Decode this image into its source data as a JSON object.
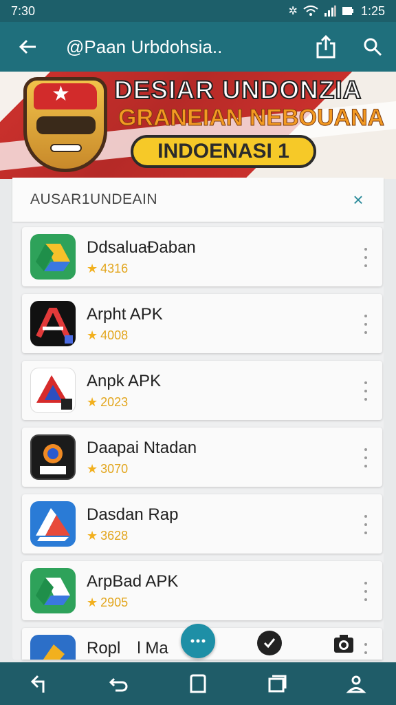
{
  "status_bar": {
    "time": "7:30",
    "clock": "1:25"
  },
  "app_bar": {
    "title": "@Paan Urbdohsia.."
  },
  "banner": {
    "line1": "DESIAR UNDONZIA",
    "line2": "GRANEIAN NEBOUANA",
    "pill": "INDOENASI 1"
  },
  "panel": {
    "header": "AUSAR1UNDEAIN",
    "close_label": "×",
    "apps": [
      {
        "name": "DdsaluaĐaban",
        "rating": "4316",
        "icon": "drive-green-icon"
      },
      {
        "name": "Arpht APK",
        "rating": "4008",
        "icon": "apk-black-icon"
      },
      {
        "name": "Anpk APK",
        "rating": "2023",
        "icon": "apk-red-icon"
      },
      {
        "name": "Daapai Ntadan",
        "rating": "3070",
        "icon": "apk-dark-icon"
      },
      {
        "name": "Dasdan Rap",
        "rating": "3628",
        "icon": "drive-blue-icon"
      },
      {
        "name": "ArpBad APK",
        "rating": "2905",
        "icon": "drive-green-icon"
      },
      {
        "name": "Ropl l Ma",
        "rating": "",
        "icon": "blue-app-icon"
      }
    ]
  },
  "colors": {
    "app_bar": "#1f6f7c",
    "status_bar": "#1d5f6a",
    "nav_bar": "#1f5c68",
    "accent": "#1e8fa6",
    "star": "#f2b01e"
  }
}
